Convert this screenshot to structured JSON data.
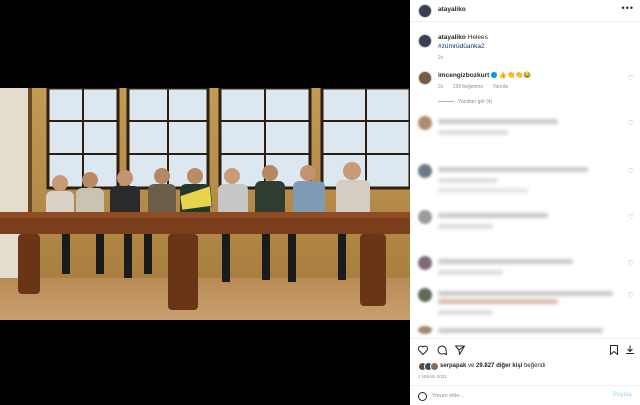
{
  "post": {
    "username": "atayaliko",
    "more_icon": "ellipsis-icon"
  },
  "caption": {
    "text": "Helees",
    "hashtag": "#zümrüdüanka2",
    "time": "2s"
  },
  "comment": {
    "username": "imcengizbozkurt",
    "text": "👍👏👏😂",
    "time": "2s",
    "likes": "159 beğenme",
    "reply": "Yanıtla",
    "view_replies": "Yanıtları gör (4)"
  },
  "likes": {
    "user": "serpapak",
    "connector": "ve",
    "count": "29.827 diğer kişi",
    "suffix": "beğendi"
  },
  "date": "1 nisan 2021",
  "add_comment": {
    "placeholder": "Yorum ekle...",
    "post_label": "Paylaş"
  },
  "colors": {
    "accent": "#0095f6",
    "link": "#00376b",
    "muted": "#8e8e8e"
  }
}
